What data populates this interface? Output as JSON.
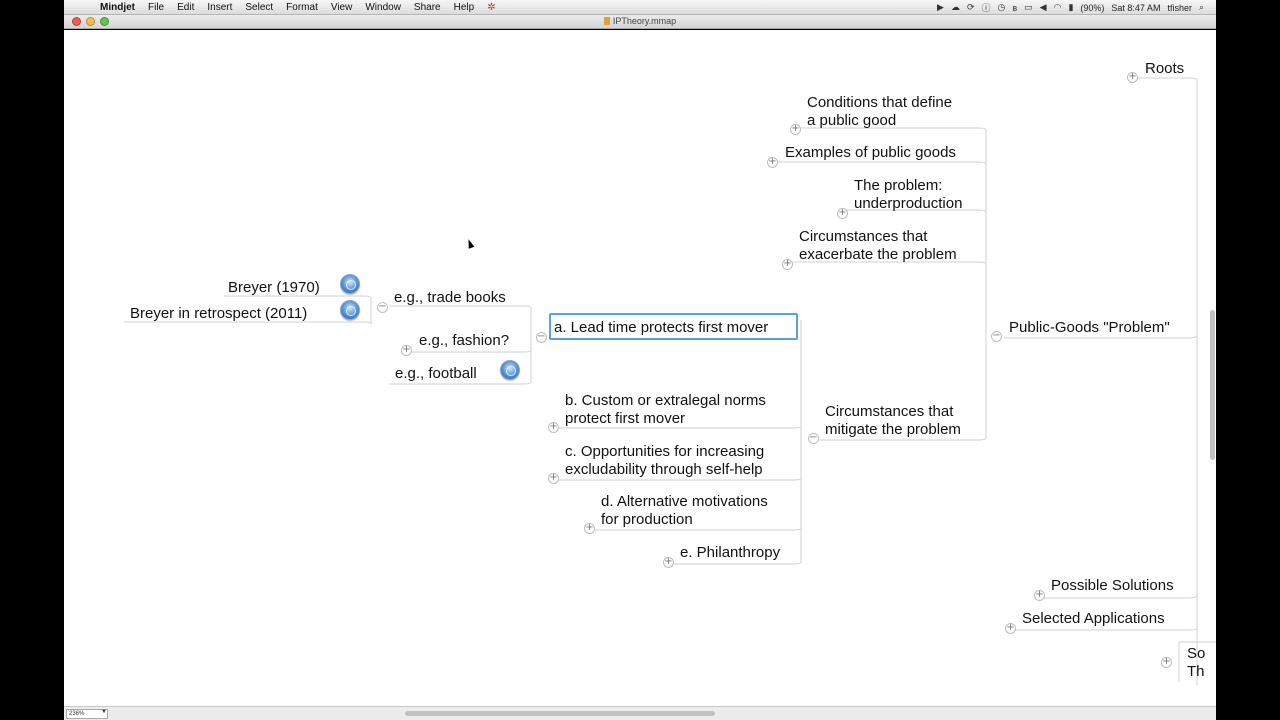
{
  "menubar": {
    "app_name": "Mindjet",
    "menus": [
      "File",
      "Edit",
      "Insert",
      "Select",
      "Format",
      "View",
      "Window",
      "Share",
      "Help"
    ],
    "script_icon": "script-menu-icon",
    "battery": "(90%)",
    "clock": "Sat 8:47 AM",
    "user": "tfisher"
  },
  "window": {
    "title": "IPTheory.mmap"
  },
  "map": {
    "roots": "Roots",
    "public_goods": "Public-Goods \"Problem\"",
    "conditions": [
      "Conditions that define",
      "a public good"
    ],
    "examples": "Examples of public goods",
    "problem": [
      "The problem:",
      "underproduction"
    ],
    "exacerbate": [
      "Circumstances that",
      "exacerbate the problem"
    ],
    "mitigate": [
      "Circumstances that",
      "mitigate the problem"
    ],
    "lead_time": "a. Lead time protects first mover",
    "norms": [
      "b. Custom or extralegal norms",
      "protect first mover"
    ],
    "excludability": [
      "c. Opportunities for increasing",
      "excludability through self-help"
    ],
    "alt_motivations": [
      "d. Alternative motivations",
      "for production"
    ],
    "philanthropy": "e. Philanthropy",
    "trade_books": "e.g., trade books",
    "fashion": "e.g., fashion?",
    "football": "e.g., football",
    "breyer_1970": "Breyer (1970)",
    "breyer_2011": "Breyer in retrospect (2011)",
    "possible_solutions": "Possible Solutions",
    "selected_applications": "Selected Applications",
    "partial_topic": [
      "So",
      "Th"
    ]
  },
  "bottombar": {
    "zoom": "236%"
  }
}
